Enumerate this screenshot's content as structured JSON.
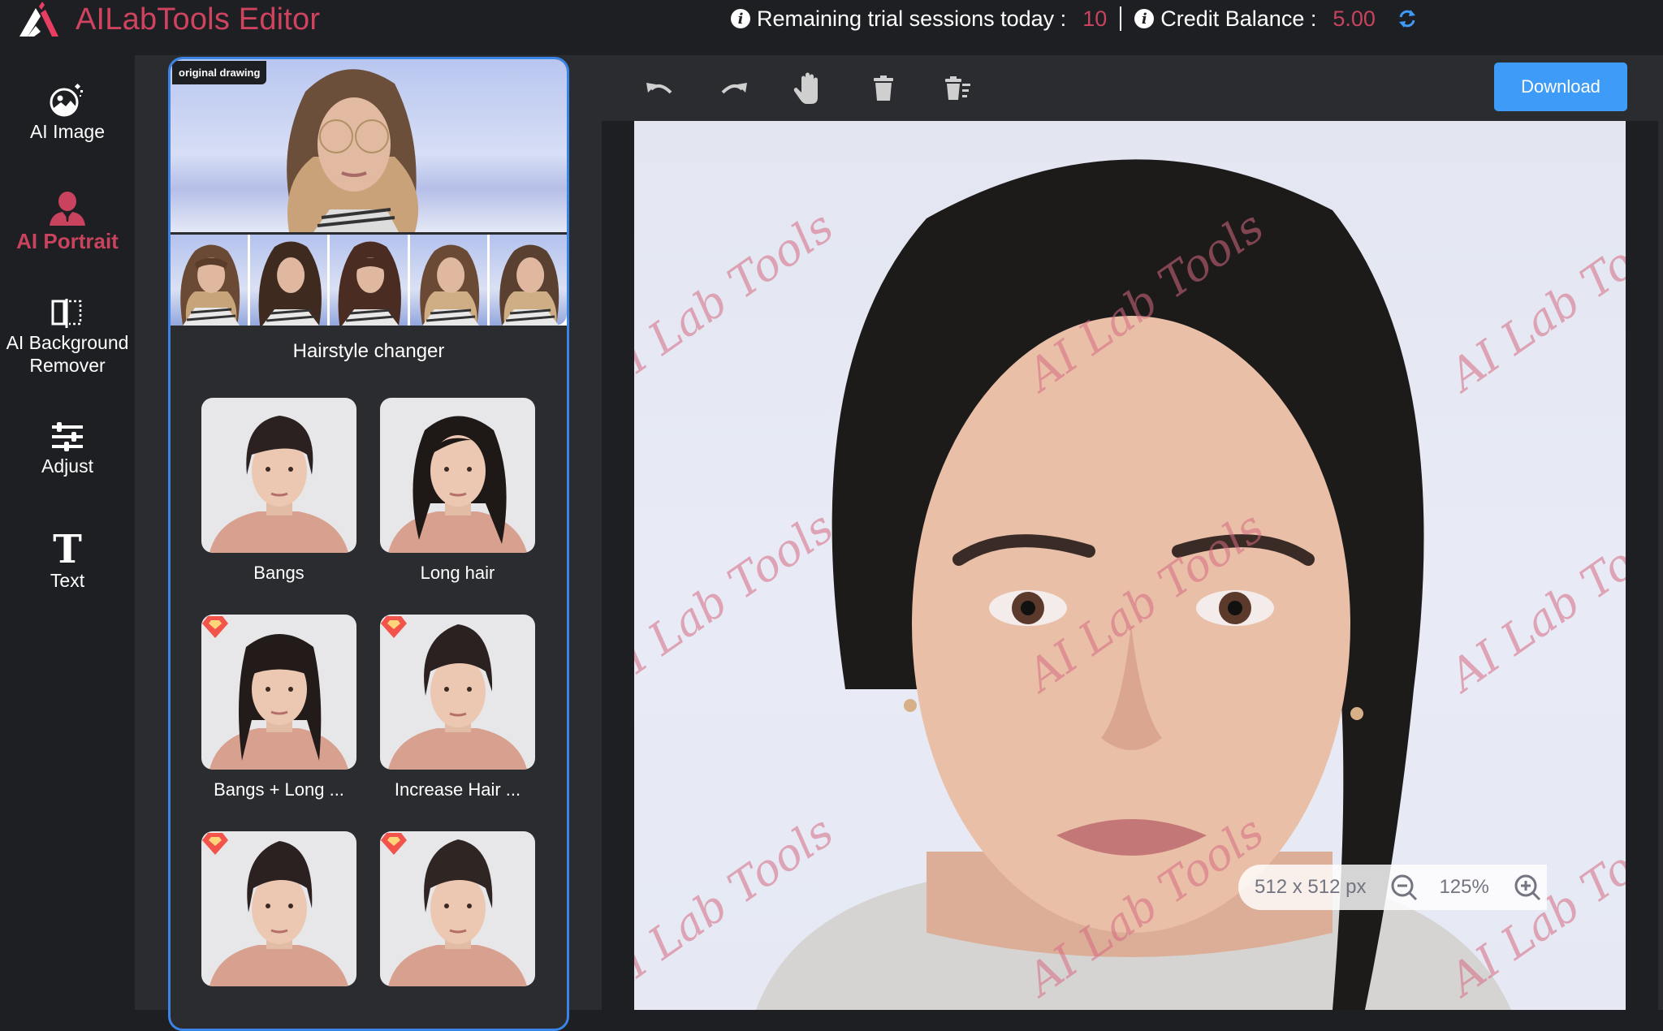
{
  "header": {
    "app_title": "AILabTools Editor",
    "remaining_label": "Remaining trial sessions today :",
    "remaining_value": "10",
    "credit_label": "Credit Balance :",
    "credit_value": "5.00",
    "accent_color": "#d0435f",
    "refresh_icon": "refresh-icon",
    "info_icon": "info-icon"
  },
  "sidebar": {
    "items": [
      {
        "label": "AI Image",
        "icon": "ai-image-icon",
        "active": false
      },
      {
        "label": "AI Portrait",
        "icon": "portrait-icon",
        "active": true
      },
      {
        "label_line1": "AI Background",
        "label_line2": "Remover",
        "icon": "background-remover-icon",
        "active": false
      },
      {
        "label": "Adjust",
        "icon": "sliders-icon",
        "active": false
      },
      {
        "label": "Text",
        "icon": "text-icon",
        "active": false
      }
    ]
  },
  "panel": {
    "card": {
      "badge": "original drawing",
      "title": "Hairstyle changer",
      "thumbnail_count": 5
    },
    "styles": [
      {
        "label": "Bangs",
        "premium": false
      },
      {
        "label": "Long hair",
        "premium": false
      },
      {
        "label": "Bangs + Long ...",
        "premium": true
      },
      {
        "label": "Increase Hair ...",
        "premium": true
      },
      {
        "label": "",
        "premium": true
      },
      {
        "label": "",
        "premium": true
      }
    ]
  },
  "toolbar": {
    "tools": [
      "undo-icon",
      "redo-icon",
      "hand-icon",
      "trash-icon",
      "clear-all-icon"
    ],
    "download_label": "Download",
    "download_color": "#3e9bf7"
  },
  "canvas": {
    "watermark": "AI Lab Tools",
    "image_size": "512 x 512 px",
    "zoom_level": "125%"
  }
}
